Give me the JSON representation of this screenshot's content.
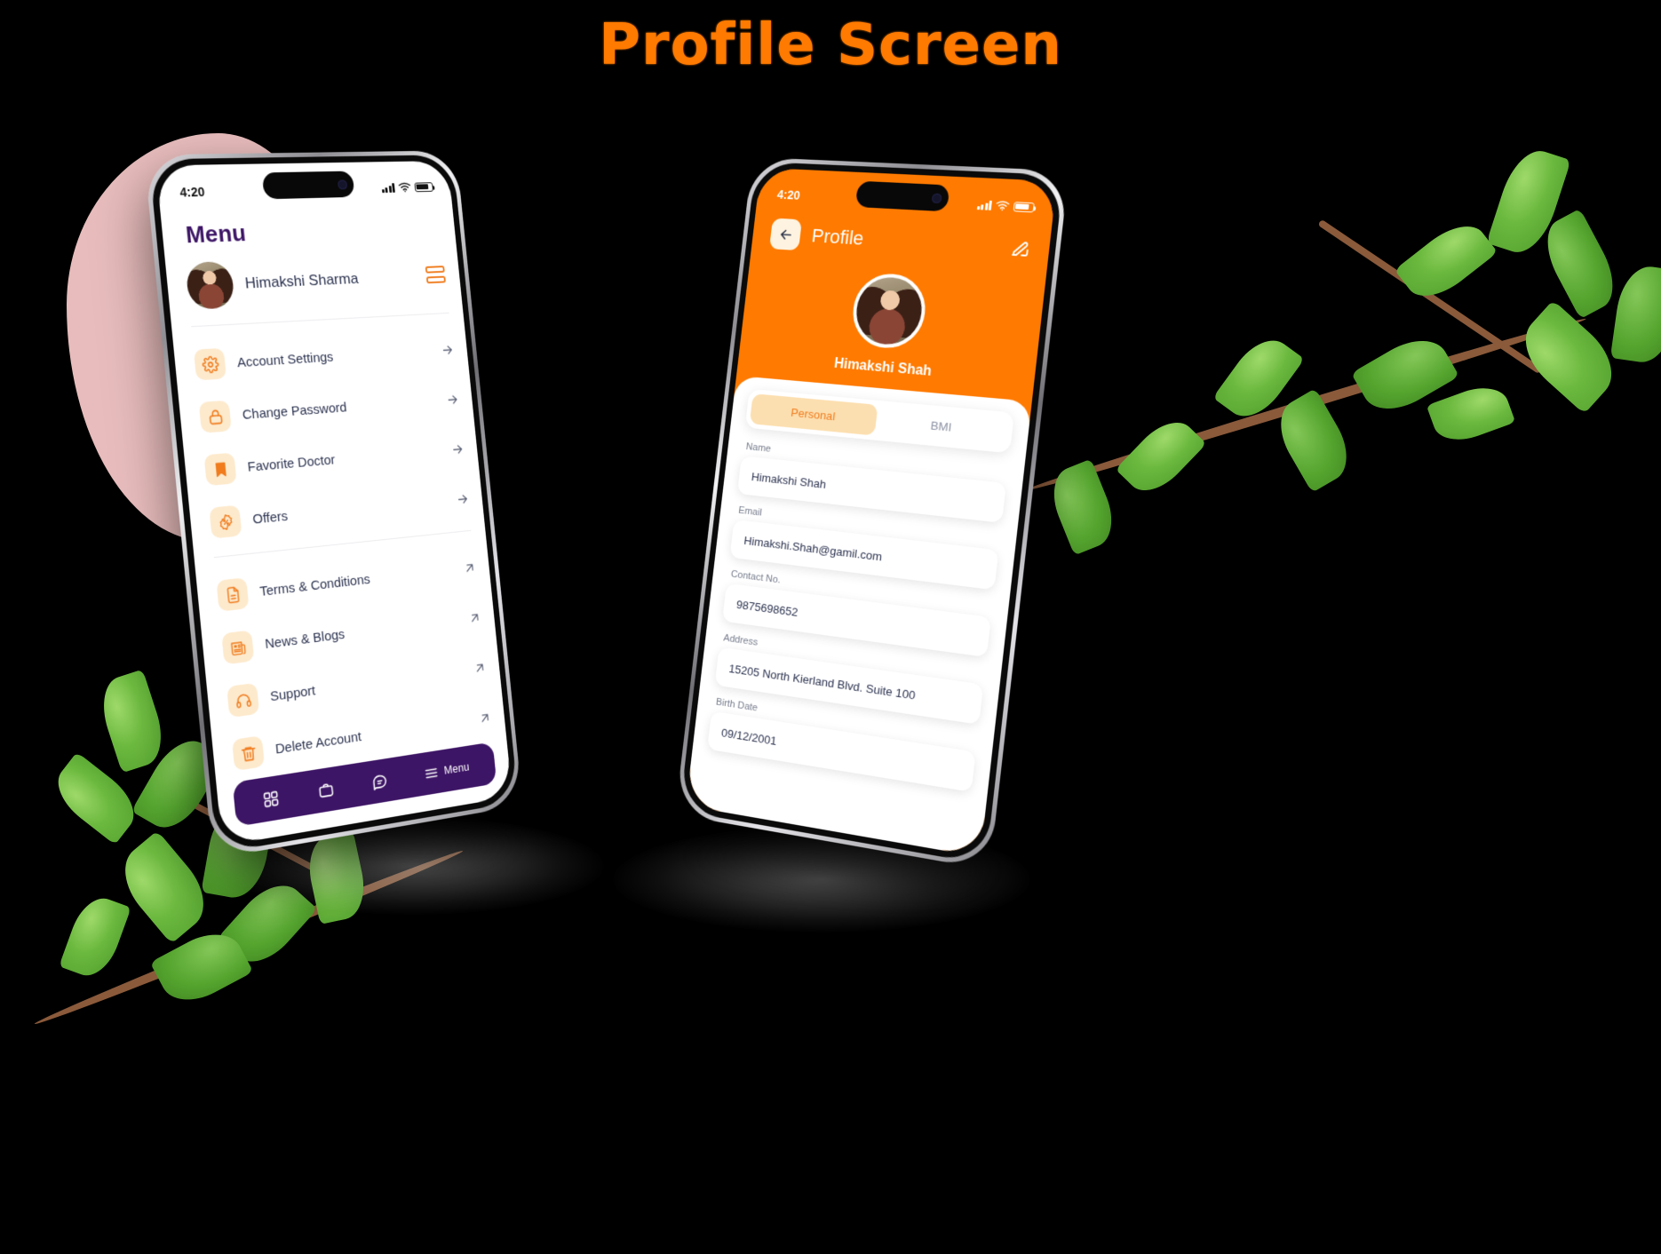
{
  "page": {
    "title": "Profile Screen"
  },
  "colors": {
    "brand_orange": "#FF7A00",
    "icon_bg_peach": "#FDEACD",
    "deep_purple": "#3D1566",
    "text_navy": "#2C3350",
    "pink_blob": "#E8BCBC",
    "leaf_green": "#6CB93F"
  },
  "menu_phone": {
    "status": {
      "time": "4:20",
      "signal_icon": "cellular-bars-icon",
      "wifi_icon": "wifi-icon",
      "battery_icon": "battery-icon"
    },
    "screen_title": "Menu",
    "user": {
      "name": "Himakshi Sharma",
      "avatar": "user-avatar"
    },
    "card_toggle_icon": "card-stack-icon",
    "group_primary": [
      {
        "label": "Account Settings",
        "icon": "gear-icon",
        "arrow": "arrow-right-icon"
      },
      {
        "label": "Change Password",
        "icon": "lock-icon",
        "arrow": "arrow-right-icon"
      },
      {
        "label": "Favorite Doctor",
        "icon": "bookmark-icon",
        "arrow": "arrow-right-icon"
      },
      {
        "label": "Offers",
        "icon": "discount-badge-icon",
        "arrow": "arrow-right-icon"
      }
    ],
    "group_secondary": [
      {
        "label": "Terms & Conditions",
        "icon": "document-icon",
        "arrow": "arrow-up-right-icon"
      },
      {
        "label": "News & Blogs",
        "icon": "newspaper-icon",
        "arrow": "arrow-up-right-icon"
      },
      {
        "label": "Support",
        "icon": "headphones-icon",
        "arrow": "arrow-up-right-icon"
      },
      {
        "label": "Delete Account",
        "icon": "trash-icon",
        "arrow": "arrow-up-right-icon"
      }
    ],
    "tabbar": [
      {
        "label": "",
        "icon": "grid-icon"
      },
      {
        "label": "",
        "icon": "briefcase-icon"
      },
      {
        "label": "",
        "icon": "chat-icon"
      },
      {
        "label": "Menu",
        "icon": "hamburger-icon"
      }
    ]
  },
  "profile_phone": {
    "status": {
      "time": "4:20",
      "signal_icon": "cellular-bars-icon",
      "wifi_icon": "wifi-icon",
      "battery_icon": "battery-icon"
    },
    "back_icon": "arrow-left-icon",
    "title": "Profile",
    "edit_icon": "edit-pencil-icon",
    "user": {
      "name": "Himakshi Shah",
      "avatar": "user-avatar"
    },
    "tabs": [
      {
        "label": "Personal",
        "active": true
      },
      {
        "label": "BMI",
        "active": false
      }
    ],
    "fields": [
      {
        "label": "Name",
        "value": "Himakshi Shah"
      },
      {
        "label": "Email",
        "value": "Himakshi.Shah@gamil.com"
      },
      {
        "label": "Contact No.",
        "value": "9875698652"
      },
      {
        "label": "Address",
        "value": "15205 North Kierland Blvd. Suite 100"
      },
      {
        "label": "Birth Date",
        "value": "09/12/2001"
      }
    ]
  }
}
